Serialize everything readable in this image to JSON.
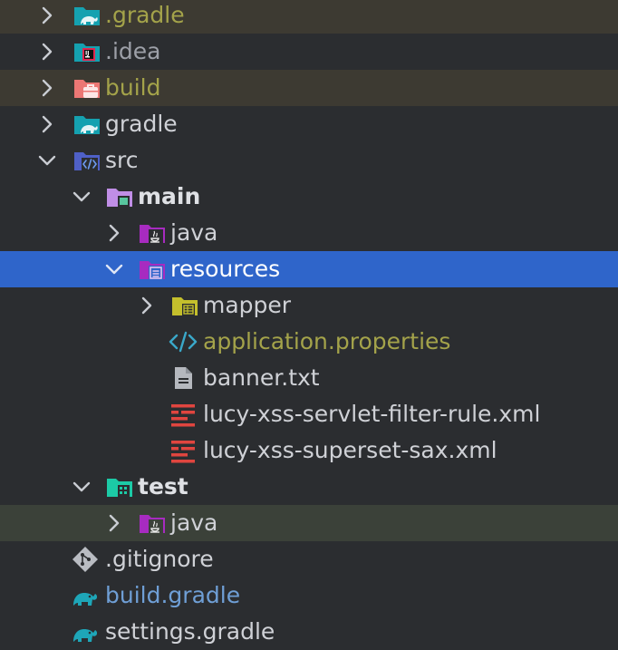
{
  "tree": {
    "items": [
      {
        "label": ".gradle"
      },
      {
        "label": ".idea"
      },
      {
        "label": "build"
      },
      {
        "label": "gradle"
      },
      {
        "label": "src"
      },
      {
        "label": "main"
      },
      {
        "label": "java"
      },
      {
        "label": "resources"
      },
      {
        "label": "mapper"
      },
      {
        "label": "application.properties"
      },
      {
        "label": "banner.txt"
      },
      {
        "label": "lucy-xss-servlet-filter-rule.xml"
      },
      {
        "label": "lucy-xss-superset-sax.xml"
      },
      {
        "label": "test"
      },
      {
        "label": "java"
      },
      {
        "label": ".gitignore"
      },
      {
        "label": "build.gradle"
      },
      {
        "label": "settings.gradle"
      }
    ]
  },
  "colors": {
    "background": "#2b2d30",
    "selected": "#2f65ca",
    "excluded_bg": "#3d3a32",
    "excluded_text": "#a4a34a",
    "gradle_blue": "#6f9fd6"
  },
  "icons": {
    "gradle_folder": "gradle-folder-icon",
    "idea_folder": "idea-folder-icon",
    "build_folder": "build-folder-icon",
    "source_root": "source-root-folder-icon",
    "module": "module-folder-icon",
    "java": "java-package-icon",
    "resources": "resources-root-icon",
    "mapper": "package-folder-icon",
    "properties": "code-icon",
    "text_file": "text-file-icon",
    "xml_file": "xml-file-icon",
    "test_module": "test-module-icon",
    "git": "git-icon",
    "gradle_file": "gradle-elephant-icon"
  }
}
